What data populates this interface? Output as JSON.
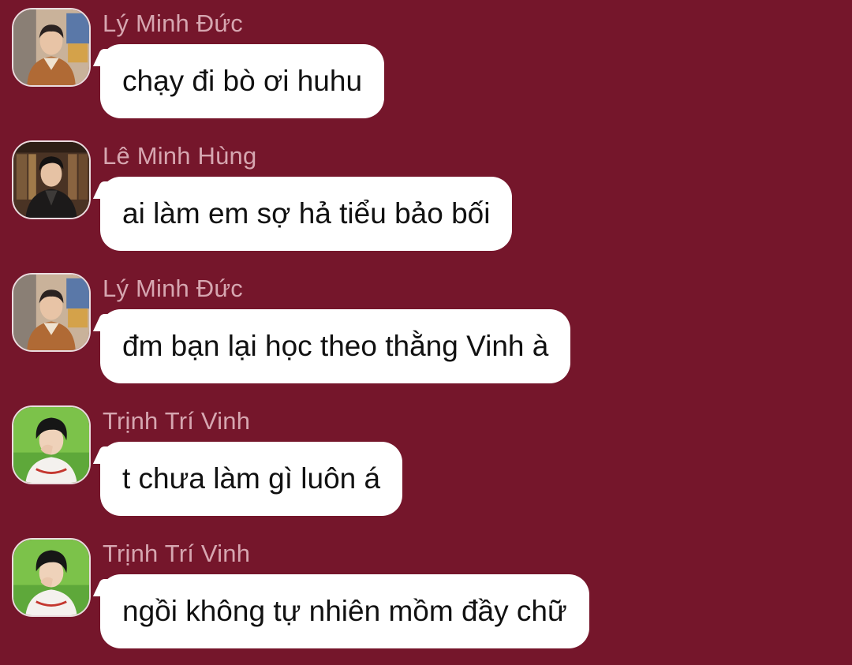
{
  "messages": [
    {
      "sender": "Lý Minh Đức",
      "avatar_icon": "avatar-ly-minh-duc",
      "text": "chạy đi bò ơi huhu"
    },
    {
      "sender": "Lê Minh Hùng",
      "avatar_icon": "avatar-le-minh-hung",
      "text": "ai làm em sợ hả tiểu bảo bối"
    },
    {
      "sender": "Lý Minh Đức",
      "avatar_icon": "avatar-ly-minh-duc",
      "text": "đm bạn lại học theo thằng Vinh à"
    },
    {
      "sender": "Trịnh Trí Vinh",
      "avatar_icon": "avatar-trinh-tri-vinh",
      "text": "t chưa làm gì luôn á"
    },
    {
      "sender": "Trịnh Trí Vinh",
      "avatar_icon": "avatar-trinh-tri-vinh",
      "text": "ngồi không tự nhiên mồm đầy chữ"
    }
  ],
  "colors": {
    "background": "#75162b",
    "bubble": "#ffffff",
    "sender_name": "#d6a6b0",
    "message_text": "#111111"
  }
}
